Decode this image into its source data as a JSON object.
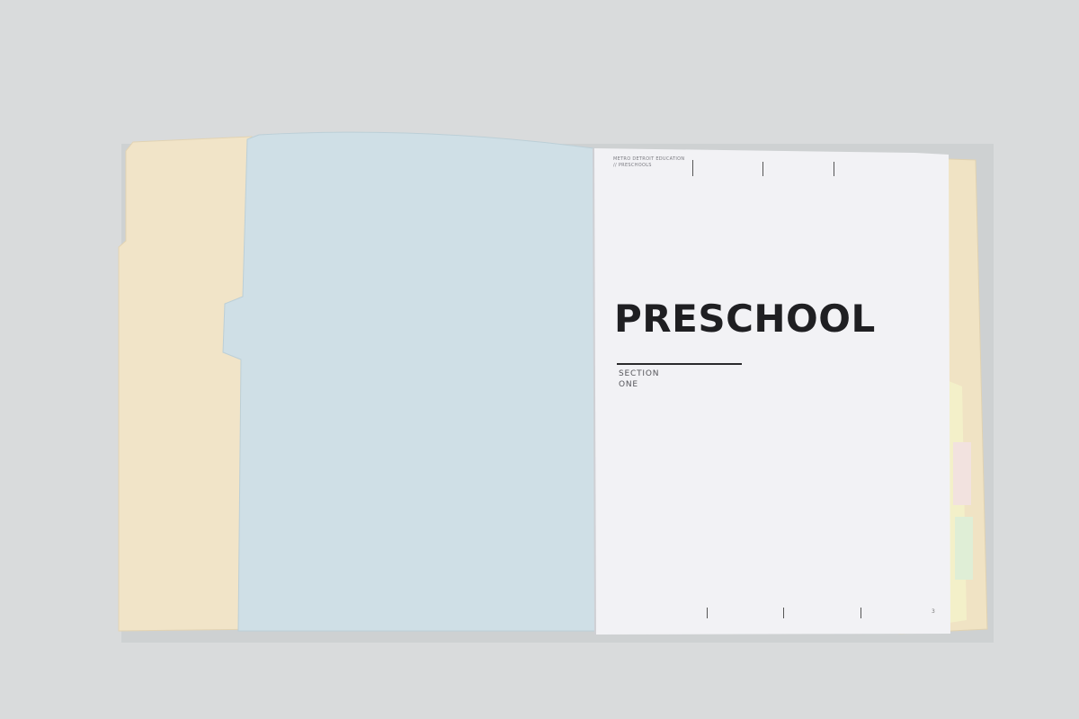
{
  "page": {
    "header_line1": "METRO DETROIT EDUCATION",
    "header_line2": "// PRESCHOOLS",
    "title": "PRESCHOOL",
    "section_label": "SECTION",
    "section_number": "ONE",
    "page_number": "3"
  },
  "colors": {
    "background": "#d9dbdc",
    "manila_folder": "#f1e4c8",
    "blue_page": "#cfdfe6",
    "white_page": "#f2f2f5",
    "title_text": "#1f1f22"
  }
}
